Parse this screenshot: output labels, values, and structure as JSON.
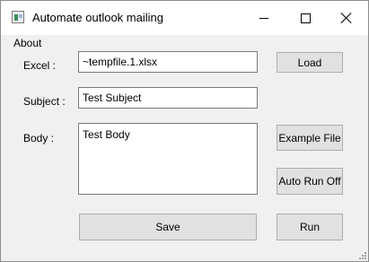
{
  "window": {
    "title": "Automate outlook mailing",
    "controls": {
      "minimize": "minimize-icon",
      "maximize": "maximize-icon",
      "close": "close-icon"
    }
  },
  "menu": {
    "items": [
      "About"
    ]
  },
  "form": {
    "excel_label": "Excel :",
    "excel_value": "~tempfile.1.xlsx",
    "subject_label": "Subject :",
    "subject_value": "Test Subject",
    "body_label": "Body :",
    "body_value": "Test Body"
  },
  "buttons": {
    "load": "Load",
    "example_file": "Example File",
    "auto_run": "Auto Run Off",
    "save": "Save",
    "run": "Run"
  },
  "colors": {
    "window_bg": "#f0f0f0",
    "titlebar_bg": "#ffffff",
    "button_bg": "#e1e1e1",
    "button_border": "#adadad",
    "field_border": "#7a7a7a"
  }
}
